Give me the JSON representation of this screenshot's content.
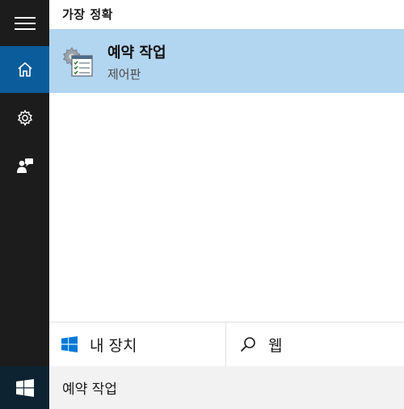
{
  "sidebar": {
    "items": [
      {
        "icon": "hamburger-menu-icon",
        "active": false
      },
      {
        "icon": "home-icon",
        "active": true
      },
      {
        "icon": "gear-icon",
        "active": false
      },
      {
        "icon": "feedback-icon",
        "active": false
      }
    ],
    "start_icon": "windows-logo-icon"
  },
  "results": {
    "section_title": "가장 정확",
    "best_match": {
      "title": "예약 작업",
      "subtitle": "제어판",
      "icon": "task-scheduler-icon"
    }
  },
  "filters": {
    "device_label": "내 장치",
    "device_icon": "windows-logo-icon",
    "web_label": "웹",
    "web_icon": "search-icon"
  },
  "search": {
    "query": "예약 작업"
  },
  "colors": {
    "sidebar_bg": "#1c1c1c",
    "active_item": "#0b5c9a",
    "result_highlight": "#b2d5f0",
    "accent_blue": "#0078d7",
    "searchbox_bg": "#f2f2f2"
  }
}
